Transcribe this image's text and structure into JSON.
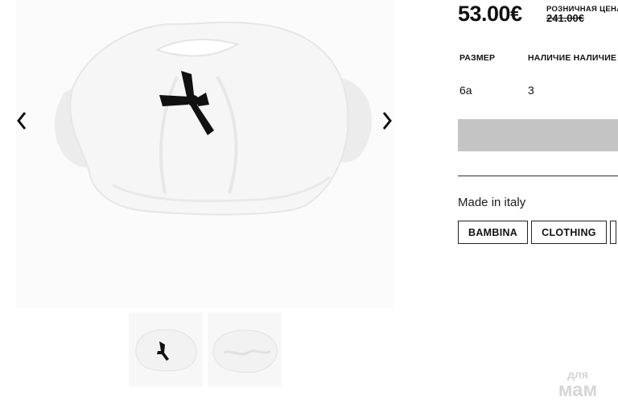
{
  "gallery": {
    "main_image": "white-fur-bolero-with-black-bow",
    "thumbnails": [
      "bolero-front",
      "bolero-back"
    ],
    "prev_icon": "chevron-left-icon",
    "next_icon": "chevron-right-icon"
  },
  "product": {
    "price": "53.00€",
    "retail_label": "РОЗНИЧНАЯ ЦЕНА",
    "retail_price": "241.00€"
  },
  "stock_table": {
    "headers": [
      "РАЗМЕР",
      "НАЛИЧИЕ НАЛИЧИЕ"
    ],
    "rows": [
      [
        "6a",
        "3"
      ]
    ]
  },
  "add_bar_color": "#c4c4c4",
  "made_in": "Made in italy",
  "tags": [
    "BAMBINA",
    "CLOTHING"
  ],
  "watermark": {
    "line1": "для",
    "line2": "мам"
  }
}
